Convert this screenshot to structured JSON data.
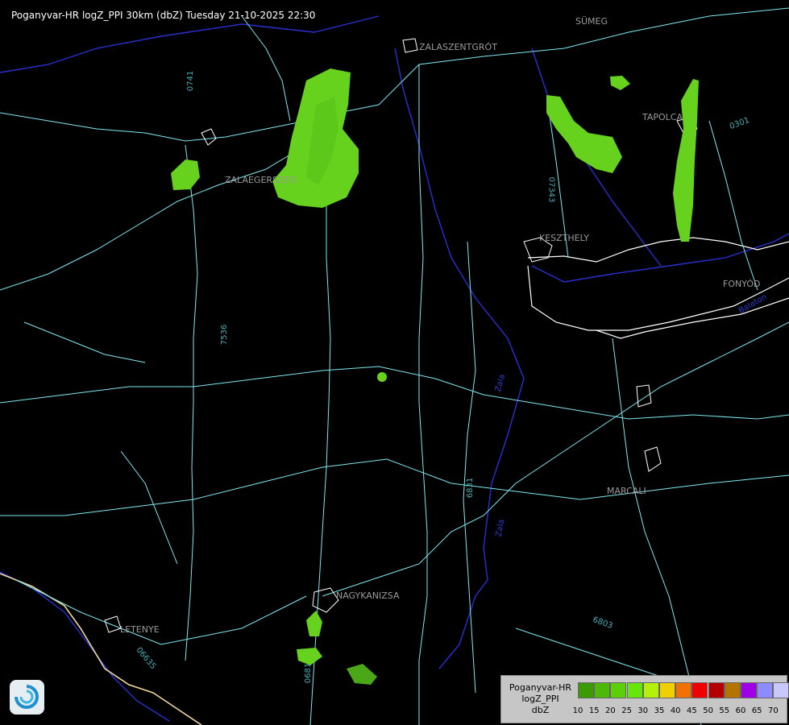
{
  "header": {
    "title": "Poganyvar-HR logZ_PPI 30km (dbZ) Tuesday 21-10-2025 22:30"
  },
  "cities": [
    "SÜMEG",
    "ZALASZENTGRÓT",
    "TAPOLCA",
    "ZALAEGERSZEG",
    "KESZTHELY",
    "FONYÓD",
    "MARCALI",
    "NAGYKANIZSA",
    "LETENYE"
  ],
  "road_labels": [
    "0741",
    "07343",
    "0301",
    "7536",
    "6831",
    "6803",
    "06635",
    "0681"
  ],
  "river_labels": [
    "Zala",
    "Zala",
    "Balaton"
  ],
  "legend": {
    "line1": "Poganyvar-HR",
    "line2": "logZ_PPI",
    "line3": "dbZ",
    "ticks": [
      "10",
      "15",
      "20",
      "25",
      "30",
      "35",
      "40",
      "45",
      "50",
      "55",
      "60",
      "65",
      "70"
    ],
    "colors": [
      "#3c9b05",
      "#4cb807",
      "#5ccf0a",
      "#66e60d",
      "#b4f00a",
      "#f0d000",
      "#f07000",
      "#f00000",
      "#b40000",
      "#b47400",
      "#a000e6",
      "#8c8cff",
      "#c8c8ff"
    ]
  },
  "map_colors": {
    "road": "#7fe8f0",
    "border": "#ffffff",
    "river": "#2830d0",
    "echo_light": "#66d21e",
    "echo_dark": "#3c9b14"
  }
}
